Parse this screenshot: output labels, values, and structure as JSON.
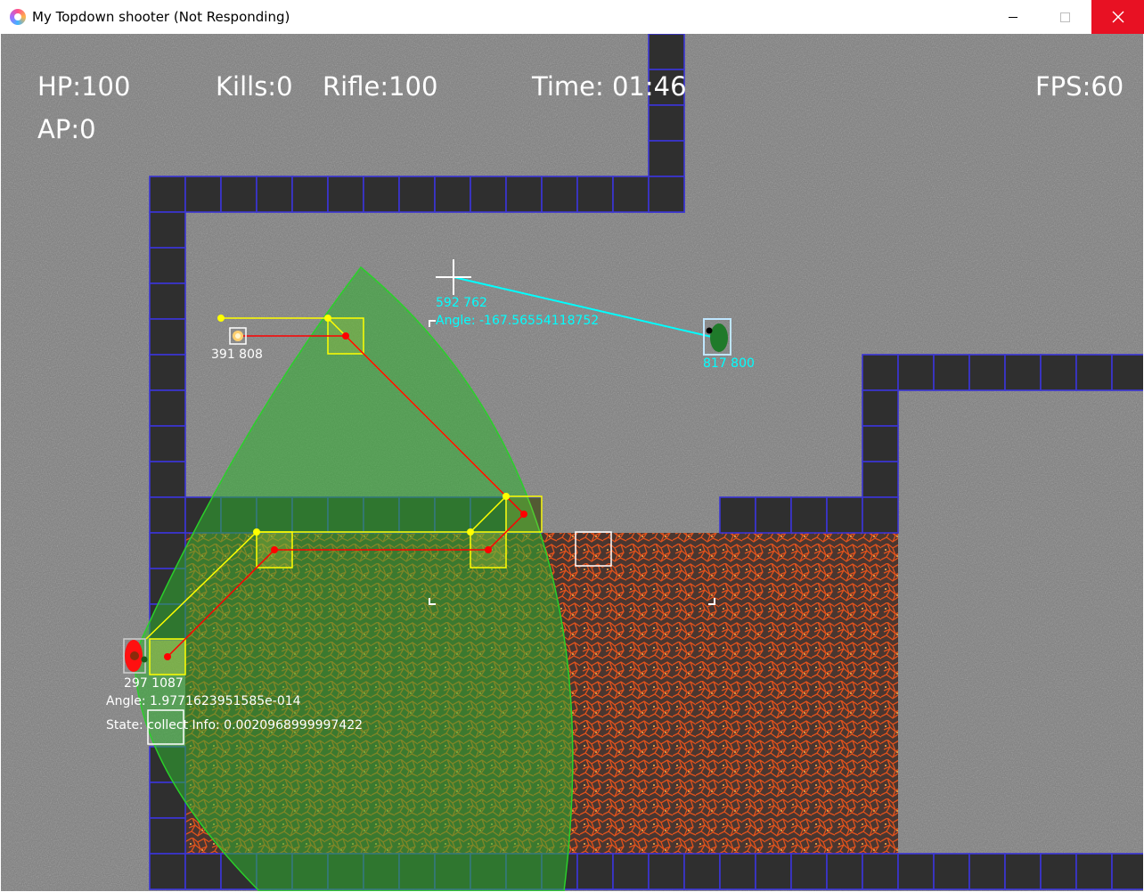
{
  "window": {
    "title": "My Topdown shooter (Not Responding)",
    "minimize_icon": "minimize-icon",
    "maximize_icon": "maximize-icon",
    "close_icon": "close-icon",
    "close_color": "#e81123"
  },
  "hud": {
    "hp": "HP:100",
    "ap": "AP:0",
    "kills": "Kills:0",
    "weapon": "Rifle:100",
    "time": "Time: 01:46",
    "fps": "FPS:60"
  },
  "debug": {
    "player_coords": "297 1087",
    "player_angle": "Angle: 1.9771623951585e-014",
    "player_state": "State: collect  Info: 0.0020968999997422",
    "pickup_coords": "391 808",
    "cursor_coords": "592 762",
    "cursor_angle": "Angle: -167.56554118752",
    "enemy_coords": "817 800"
  },
  "colors": {
    "floor": "#7d7d7d",
    "wall": "#2f2f2f",
    "wall_border": "#3b35d6",
    "vision_cone": "#2fb02f",
    "path_yellow": "#ffff00",
    "path_red": "#ff0000",
    "aim_line": "#00ffff"
  }
}
